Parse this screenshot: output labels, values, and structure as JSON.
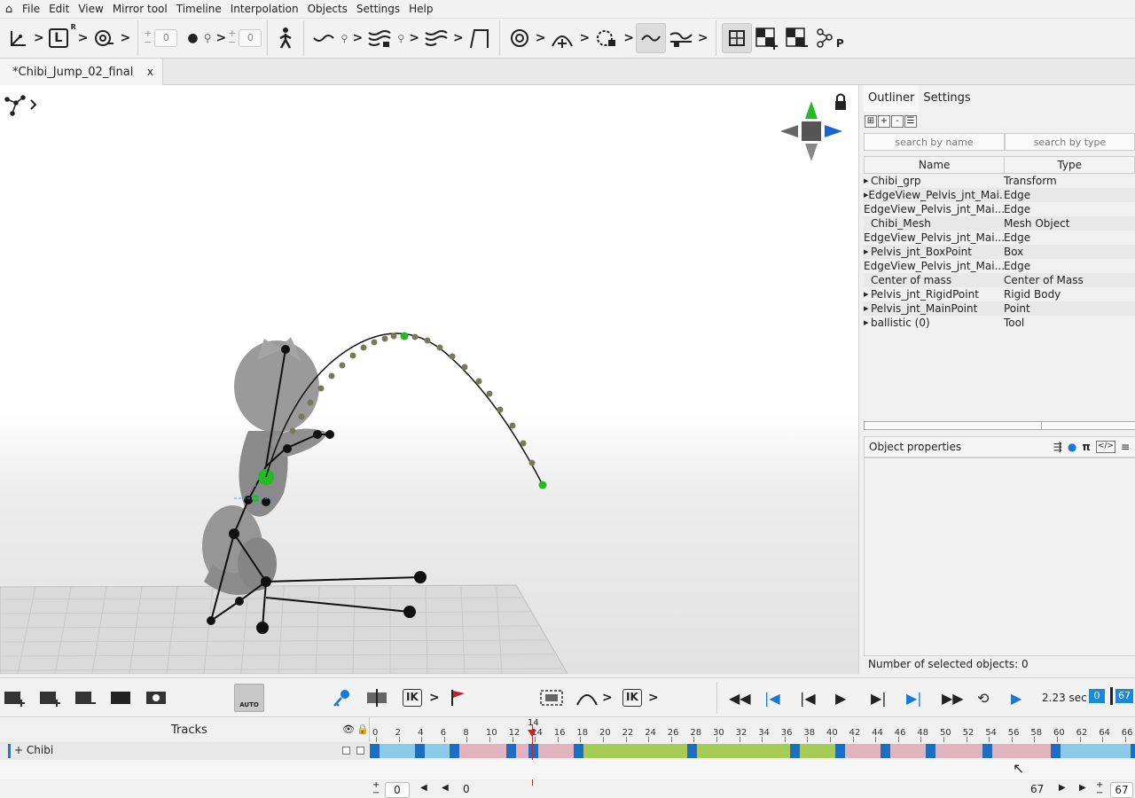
{
  "menu": [
    "File",
    "Edit",
    "View",
    "Mirror tool",
    "Timeline",
    "Interpolation",
    "Objects",
    "Settings",
    "Help"
  ],
  "toolbar": {
    "l_label": "L",
    "r_label": "R",
    "spin1_value": "0",
    "spin2_value": "0",
    "spin_plus": "+",
    "spin_minus": "−",
    "p_label": "P"
  },
  "tab": {
    "title": "*Chibi_Jump_02_final",
    "close": "x"
  },
  "outliner": {
    "tabs": [
      "Outliner",
      "Settings"
    ],
    "tools": [
      "⊞",
      "+",
      "-",
      "☰"
    ],
    "search_name_placeholder": "search by name",
    "search_type_placeholder": "search by type",
    "columns": [
      "Name",
      "Type"
    ],
    "rows": [
      {
        "name": "Chibi_grp",
        "type": "Transform",
        "expandable": true
      },
      {
        "name": "EdgeView_Pelvis_jnt_Mai...",
        "type": "Edge",
        "expandable": true
      },
      {
        "name": "EdgeView_Pelvis_jnt_Mai...",
        "type": "Edge",
        "expandable": false
      },
      {
        "name": "Chibi_Mesh",
        "type": "Mesh Object",
        "expandable": false
      },
      {
        "name": "EdgeView_Pelvis_jnt_Mai...",
        "type": "Edge",
        "expandable": false
      },
      {
        "name": "Pelvis_jnt_BoxPoint",
        "type": "Box",
        "expandable": true
      },
      {
        "name": "EdgeView_Pelvis_jnt_Mai...",
        "type": "Edge",
        "expandable": false
      },
      {
        "name": "Center of mass",
        "type": "Center of Mass",
        "expandable": false
      },
      {
        "name": "Pelvis_jnt_RigidPoint",
        "type": "Rigid Body",
        "expandable": true
      },
      {
        "name": "Pelvis_jnt_MainPoint",
        "type": "Point",
        "expandable": true
      },
      {
        "name": "ballistic (0)",
        "type": "Tool",
        "expandable": true
      }
    ]
  },
  "properties": {
    "title": "Object properties",
    "selected_count": "Number of selected objects: 0"
  },
  "anim": {
    "auto_label": "AUTO",
    "ik_label": "IK",
    "time": "2.23 sec",
    "current_frame": "0",
    "end_frame": "67"
  },
  "timeline": {
    "tracks_label": "Tracks",
    "track_name": "Chibi",
    "track_plus": "+",
    "playhead_frame": "14",
    "ticks": [
      "0",
      "2",
      "4",
      "6",
      "8",
      "10",
      "12",
      "14",
      "16",
      "18",
      "20",
      "22",
      "24",
      "26",
      "28",
      "30",
      "32",
      "34",
      "36",
      "38",
      "40",
      "42",
      "44",
      "46",
      "48",
      "50",
      "52",
      "54",
      "56",
      "58",
      "60",
      "62",
      "64",
      "66"
    ],
    "range_start_spin": "0",
    "range_start": "0",
    "range_end": "67",
    "range_end_spin": "67",
    "colors": {
      "blue": "#8ccbe8",
      "pink": "#e3b2c0",
      "green": "#a6cc55",
      "key": "#1a6ec4"
    }
  }
}
